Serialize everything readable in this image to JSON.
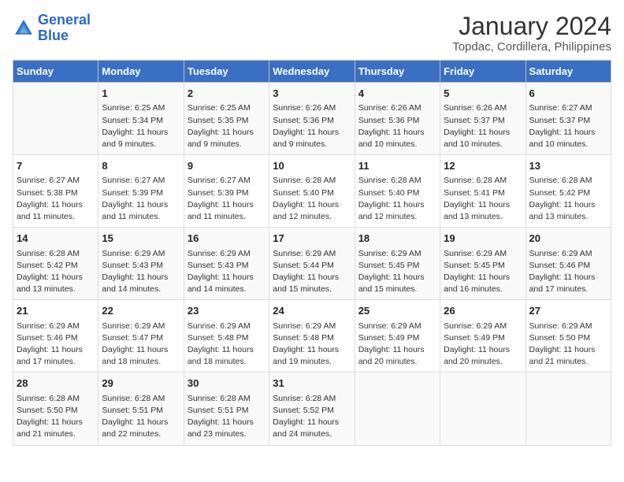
{
  "header": {
    "logo_line1": "General",
    "logo_line2": "Blue",
    "title": "January 2024",
    "subtitle": "Topdac, Cordillera, Philippines"
  },
  "weekdays": [
    "Sunday",
    "Monday",
    "Tuesday",
    "Wednesday",
    "Thursday",
    "Friday",
    "Saturday"
  ],
  "weeks": [
    [
      {
        "day": "",
        "info": ""
      },
      {
        "day": "1",
        "info": "Sunrise: 6:25 AM\nSunset: 5:34 PM\nDaylight: 11 hours\nand 9 minutes."
      },
      {
        "day": "2",
        "info": "Sunrise: 6:25 AM\nSunset: 5:35 PM\nDaylight: 11 hours\nand 9 minutes."
      },
      {
        "day": "3",
        "info": "Sunrise: 6:26 AM\nSunset: 5:36 PM\nDaylight: 11 hours\nand 9 minutes."
      },
      {
        "day": "4",
        "info": "Sunrise: 6:26 AM\nSunset: 5:36 PM\nDaylight: 11 hours\nand 10 minutes."
      },
      {
        "day": "5",
        "info": "Sunrise: 6:26 AM\nSunset: 5:37 PM\nDaylight: 11 hours\nand 10 minutes."
      },
      {
        "day": "6",
        "info": "Sunrise: 6:27 AM\nSunset: 5:37 PM\nDaylight: 11 hours\nand 10 minutes."
      }
    ],
    [
      {
        "day": "7",
        "info": "Sunrise: 6:27 AM\nSunset: 5:38 PM\nDaylight: 11 hours\nand 11 minutes."
      },
      {
        "day": "8",
        "info": "Sunrise: 6:27 AM\nSunset: 5:39 PM\nDaylight: 11 hours\nand 11 minutes."
      },
      {
        "day": "9",
        "info": "Sunrise: 6:27 AM\nSunset: 5:39 PM\nDaylight: 11 hours\nand 11 minutes."
      },
      {
        "day": "10",
        "info": "Sunrise: 6:28 AM\nSunset: 5:40 PM\nDaylight: 11 hours\nand 12 minutes."
      },
      {
        "day": "11",
        "info": "Sunrise: 6:28 AM\nSunset: 5:40 PM\nDaylight: 11 hours\nand 12 minutes."
      },
      {
        "day": "12",
        "info": "Sunrise: 6:28 AM\nSunset: 5:41 PM\nDaylight: 11 hours\nand 13 minutes."
      },
      {
        "day": "13",
        "info": "Sunrise: 6:28 AM\nSunset: 5:42 PM\nDaylight: 11 hours\nand 13 minutes."
      }
    ],
    [
      {
        "day": "14",
        "info": "Sunrise: 6:28 AM\nSunset: 5:42 PM\nDaylight: 11 hours\nand 13 minutes."
      },
      {
        "day": "15",
        "info": "Sunrise: 6:29 AM\nSunset: 5:43 PM\nDaylight: 11 hours\nand 14 minutes."
      },
      {
        "day": "16",
        "info": "Sunrise: 6:29 AM\nSunset: 5:43 PM\nDaylight: 11 hours\nand 14 minutes."
      },
      {
        "day": "17",
        "info": "Sunrise: 6:29 AM\nSunset: 5:44 PM\nDaylight: 11 hours\nand 15 minutes."
      },
      {
        "day": "18",
        "info": "Sunrise: 6:29 AM\nSunset: 5:45 PM\nDaylight: 11 hours\nand 15 minutes."
      },
      {
        "day": "19",
        "info": "Sunrise: 6:29 AM\nSunset: 5:45 PM\nDaylight: 11 hours\nand 16 minutes."
      },
      {
        "day": "20",
        "info": "Sunrise: 6:29 AM\nSunset: 5:46 PM\nDaylight: 11 hours\nand 17 minutes."
      }
    ],
    [
      {
        "day": "21",
        "info": "Sunrise: 6:29 AM\nSunset: 5:46 PM\nDaylight: 11 hours\nand 17 minutes."
      },
      {
        "day": "22",
        "info": "Sunrise: 6:29 AM\nSunset: 5:47 PM\nDaylight: 11 hours\nand 18 minutes."
      },
      {
        "day": "23",
        "info": "Sunrise: 6:29 AM\nSunset: 5:48 PM\nDaylight: 11 hours\nand 18 minutes."
      },
      {
        "day": "24",
        "info": "Sunrise: 6:29 AM\nSunset: 5:48 PM\nDaylight: 11 hours\nand 19 minutes."
      },
      {
        "day": "25",
        "info": "Sunrise: 6:29 AM\nSunset: 5:49 PM\nDaylight: 11 hours\nand 20 minutes."
      },
      {
        "day": "26",
        "info": "Sunrise: 6:29 AM\nSunset: 5:49 PM\nDaylight: 11 hours\nand 20 minutes."
      },
      {
        "day": "27",
        "info": "Sunrise: 6:29 AM\nSunset: 5:50 PM\nDaylight: 11 hours\nand 21 minutes."
      }
    ],
    [
      {
        "day": "28",
        "info": "Sunrise: 6:28 AM\nSunset: 5:50 PM\nDaylight: 11 hours\nand 21 minutes."
      },
      {
        "day": "29",
        "info": "Sunrise: 6:28 AM\nSunset: 5:51 PM\nDaylight: 11 hours\nand 22 minutes."
      },
      {
        "day": "30",
        "info": "Sunrise: 6:28 AM\nSunset: 5:51 PM\nDaylight: 11 hours\nand 23 minutes."
      },
      {
        "day": "31",
        "info": "Sunrise: 6:28 AM\nSunset: 5:52 PM\nDaylight: 11 hours\nand 24 minutes."
      },
      {
        "day": "",
        "info": ""
      },
      {
        "day": "",
        "info": ""
      },
      {
        "day": "",
        "info": ""
      }
    ]
  ]
}
